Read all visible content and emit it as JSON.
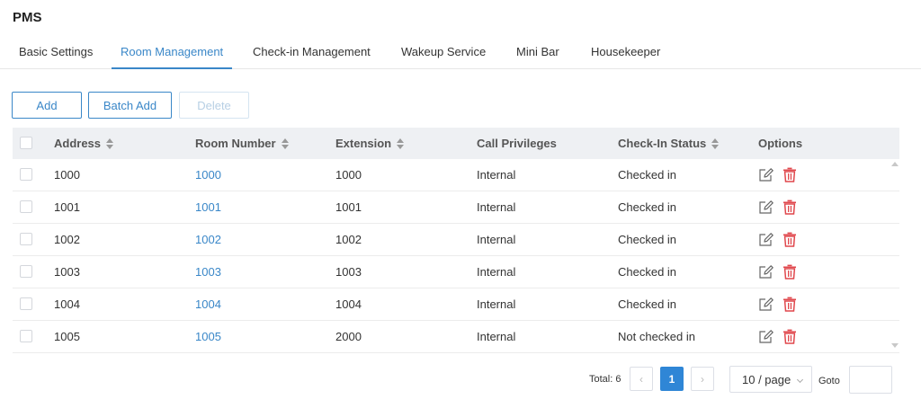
{
  "app": {
    "title": "PMS"
  },
  "tabs": [
    {
      "label": "Basic Settings"
    },
    {
      "label": "Room Management"
    },
    {
      "label": "Check-in Management"
    },
    {
      "label": "Wakeup Service"
    },
    {
      "label": "Mini Bar"
    },
    {
      "label": "Housekeeper"
    }
  ],
  "active_tab": "Room Management",
  "toolbar": {
    "add_label": "Add",
    "batch_add_label": "Batch Add",
    "delete_label": "Delete"
  },
  "table": {
    "columns": [
      "Address",
      "Room Number",
      "Extension",
      "Call Privileges",
      "Check-In Status",
      "Options"
    ],
    "rows": [
      {
        "address": "1000",
        "room": "1000",
        "extension": "1000",
        "privileges": "Internal",
        "status": "Checked in"
      },
      {
        "address": "1001",
        "room": "1001",
        "extension": "1001",
        "privileges": "Internal",
        "status": "Checked in"
      },
      {
        "address": "1002",
        "room": "1002",
        "extension": "1002",
        "privileges": "Internal",
        "status": "Checked in"
      },
      {
        "address": "1003",
        "room": "1003",
        "extension": "1003",
        "privileges": "Internal",
        "status": "Checked in"
      },
      {
        "address": "1004",
        "room": "1004",
        "extension": "1004",
        "privileges": "Internal",
        "status": "Checked in"
      },
      {
        "address": "1005",
        "room": "1005",
        "extension": "2000",
        "privileges": "Internal",
        "status": "Not checked in"
      }
    ]
  },
  "pagination": {
    "total_label": "Total: 6",
    "prev": "‹",
    "current_page": "1",
    "next": "›",
    "page_size": "10 / page",
    "goto_label": "Goto"
  },
  "colors": {
    "accent": "#3a87c8",
    "delete_icon": "#e0474c",
    "edit_icon": "#666666"
  },
  "icons": {
    "edit": "edit-icon",
    "delete": "trash-icon"
  }
}
